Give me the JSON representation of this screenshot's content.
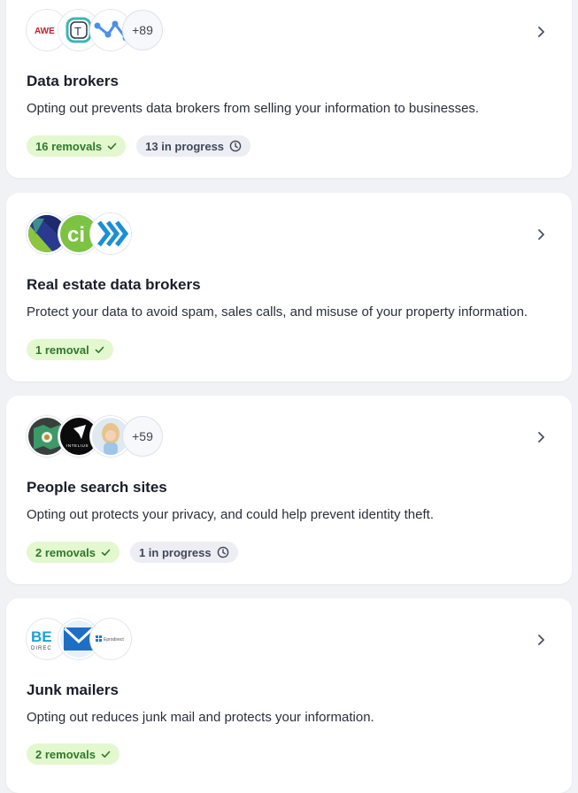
{
  "cards": [
    {
      "title": "Data brokers",
      "description": "Opting out prevents data brokers from selling your information to businesses.",
      "logos": [
        {
          "name": "awe-logo",
          "text": "AWE"
        },
        {
          "name": "t-logo",
          "text": "T"
        },
        {
          "name": "network-logo",
          "text": ""
        }
      ],
      "more_count": "+89",
      "badges": [
        {
          "label": "16 removals",
          "kind": "green",
          "icon": "check-icon"
        },
        {
          "label": "13 in progress",
          "kind": "grey",
          "icon": "clock-icon"
        }
      ]
    },
    {
      "title": "Real estate data brokers",
      "description": "Protect your data to avoid spam, sales calls, and misuse of your property information.",
      "logos": [
        {
          "name": "k-logo",
          "text": ""
        },
        {
          "name": "ci-logo",
          "text": "ci"
        },
        {
          "name": "chevrons-logo",
          "text": ""
        }
      ],
      "more_count": "",
      "badges": [
        {
          "label": "1 removal",
          "kind": "green",
          "icon": "check-icon"
        }
      ]
    },
    {
      "title": "People search sites",
      "description": "Opting out protects your privacy, and could help prevent identity theft.",
      "logos": [
        {
          "name": "map-logo",
          "text": ""
        },
        {
          "name": "inteliuz-logo",
          "text": "INTELIUS"
        },
        {
          "name": "person-photo-logo",
          "text": ""
        }
      ],
      "more_count": "+59",
      "badges": [
        {
          "label": "2 removals",
          "kind": "green",
          "icon": "check-icon"
        },
        {
          "label": "1 in progress",
          "kind": "grey",
          "icon": "clock-icon"
        }
      ]
    },
    {
      "title": "Junk mailers",
      "description": "Opting out reduces junk mail and protects your information.",
      "logos": [
        {
          "name": "be-direct-logo",
          "text": "BE DIREC"
        },
        {
          "name": "mail-logo",
          "text": ""
        },
        {
          "name": "eprodirect-logo",
          "text": "Eprodirect"
        }
      ],
      "more_count": "",
      "badges": [
        {
          "label": "2 removals",
          "kind": "green",
          "icon": "check-icon"
        }
      ]
    }
  ],
  "colors": {
    "green_bg": "#e3f8cf",
    "green_text": "#2f7a2c",
    "grey_bg": "#eceef4",
    "grey_text": "#404758"
  }
}
